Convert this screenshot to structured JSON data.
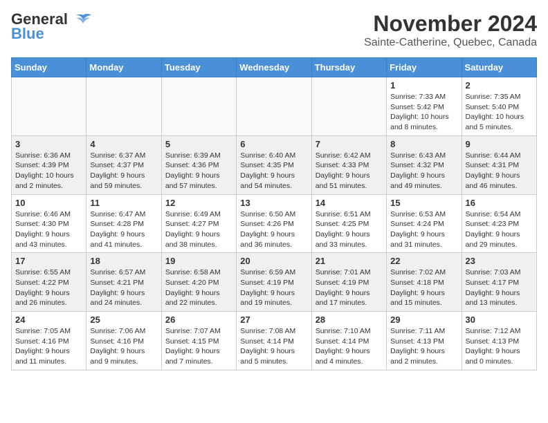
{
  "header": {
    "logo_line1": "General",
    "logo_line2": "Blue",
    "month_title": "November 2024",
    "location": "Sainte-Catherine, Quebec, Canada"
  },
  "days_of_week": [
    "Sunday",
    "Monday",
    "Tuesday",
    "Wednesday",
    "Thursday",
    "Friday",
    "Saturday"
  ],
  "weeks": [
    [
      {
        "day": "",
        "info": ""
      },
      {
        "day": "",
        "info": ""
      },
      {
        "day": "",
        "info": ""
      },
      {
        "day": "",
        "info": ""
      },
      {
        "day": "",
        "info": ""
      },
      {
        "day": "1",
        "info": "Sunrise: 7:33 AM\nSunset: 5:42 PM\nDaylight: 10 hours and 8 minutes."
      },
      {
        "day": "2",
        "info": "Sunrise: 7:35 AM\nSunset: 5:40 PM\nDaylight: 10 hours and 5 minutes."
      }
    ],
    [
      {
        "day": "3",
        "info": "Sunrise: 6:36 AM\nSunset: 4:39 PM\nDaylight: 10 hours and 2 minutes."
      },
      {
        "day": "4",
        "info": "Sunrise: 6:37 AM\nSunset: 4:37 PM\nDaylight: 9 hours and 59 minutes."
      },
      {
        "day": "5",
        "info": "Sunrise: 6:39 AM\nSunset: 4:36 PM\nDaylight: 9 hours and 57 minutes."
      },
      {
        "day": "6",
        "info": "Sunrise: 6:40 AM\nSunset: 4:35 PM\nDaylight: 9 hours and 54 minutes."
      },
      {
        "day": "7",
        "info": "Sunrise: 6:42 AM\nSunset: 4:33 PM\nDaylight: 9 hours and 51 minutes."
      },
      {
        "day": "8",
        "info": "Sunrise: 6:43 AM\nSunset: 4:32 PM\nDaylight: 9 hours and 49 minutes."
      },
      {
        "day": "9",
        "info": "Sunrise: 6:44 AM\nSunset: 4:31 PM\nDaylight: 9 hours and 46 minutes."
      }
    ],
    [
      {
        "day": "10",
        "info": "Sunrise: 6:46 AM\nSunset: 4:30 PM\nDaylight: 9 hours and 43 minutes."
      },
      {
        "day": "11",
        "info": "Sunrise: 6:47 AM\nSunset: 4:28 PM\nDaylight: 9 hours and 41 minutes."
      },
      {
        "day": "12",
        "info": "Sunrise: 6:49 AM\nSunset: 4:27 PM\nDaylight: 9 hours and 38 minutes."
      },
      {
        "day": "13",
        "info": "Sunrise: 6:50 AM\nSunset: 4:26 PM\nDaylight: 9 hours and 36 minutes."
      },
      {
        "day": "14",
        "info": "Sunrise: 6:51 AM\nSunset: 4:25 PM\nDaylight: 9 hours and 33 minutes."
      },
      {
        "day": "15",
        "info": "Sunrise: 6:53 AM\nSunset: 4:24 PM\nDaylight: 9 hours and 31 minutes."
      },
      {
        "day": "16",
        "info": "Sunrise: 6:54 AM\nSunset: 4:23 PM\nDaylight: 9 hours and 29 minutes."
      }
    ],
    [
      {
        "day": "17",
        "info": "Sunrise: 6:55 AM\nSunset: 4:22 PM\nDaylight: 9 hours and 26 minutes."
      },
      {
        "day": "18",
        "info": "Sunrise: 6:57 AM\nSunset: 4:21 PM\nDaylight: 9 hours and 24 minutes."
      },
      {
        "day": "19",
        "info": "Sunrise: 6:58 AM\nSunset: 4:20 PM\nDaylight: 9 hours and 22 minutes."
      },
      {
        "day": "20",
        "info": "Sunrise: 6:59 AM\nSunset: 4:19 PM\nDaylight: 9 hours and 19 minutes."
      },
      {
        "day": "21",
        "info": "Sunrise: 7:01 AM\nSunset: 4:19 PM\nDaylight: 9 hours and 17 minutes."
      },
      {
        "day": "22",
        "info": "Sunrise: 7:02 AM\nSunset: 4:18 PM\nDaylight: 9 hours and 15 minutes."
      },
      {
        "day": "23",
        "info": "Sunrise: 7:03 AM\nSunset: 4:17 PM\nDaylight: 9 hours and 13 minutes."
      }
    ],
    [
      {
        "day": "24",
        "info": "Sunrise: 7:05 AM\nSunset: 4:16 PM\nDaylight: 9 hours and 11 minutes."
      },
      {
        "day": "25",
        "info": "Sunrise: 7:06 AM\nSunset: 4:16 PM\nDaylight: 9 hours and 9 minutes."
      },
      {
        "day": "26",
        "info": "Sunrise: 7:07 AM\nSunset: 4:15 PM\nDaylight: 9 hours and 7 minutes."
      },
      {
        "day": "27",
        "info": "Sunrise: 7:08 AM\nSunset: 4:14 PM\nDaylight: 9 hours and 5 minutes."
      },
      {
        "day": "28",
        "info": "Sunrise: 7:10 AM\nSunset: 4:14 PM\nDaylight: 9 hours and 4 minutes."
      },
      {
        "day": "29",
        "info": "Sunrise: 7:11 AM\nSunset: 4:13 PM\nDaylight: 9 hours and 2 minutes."
      },
      {
        "day": "30",
        "info": "Sunrise: 7:12 AM\nSunset: 4:13 PM\nDaylight: 9 hours and 0 minutes."
      }
    ]
  ]
}
